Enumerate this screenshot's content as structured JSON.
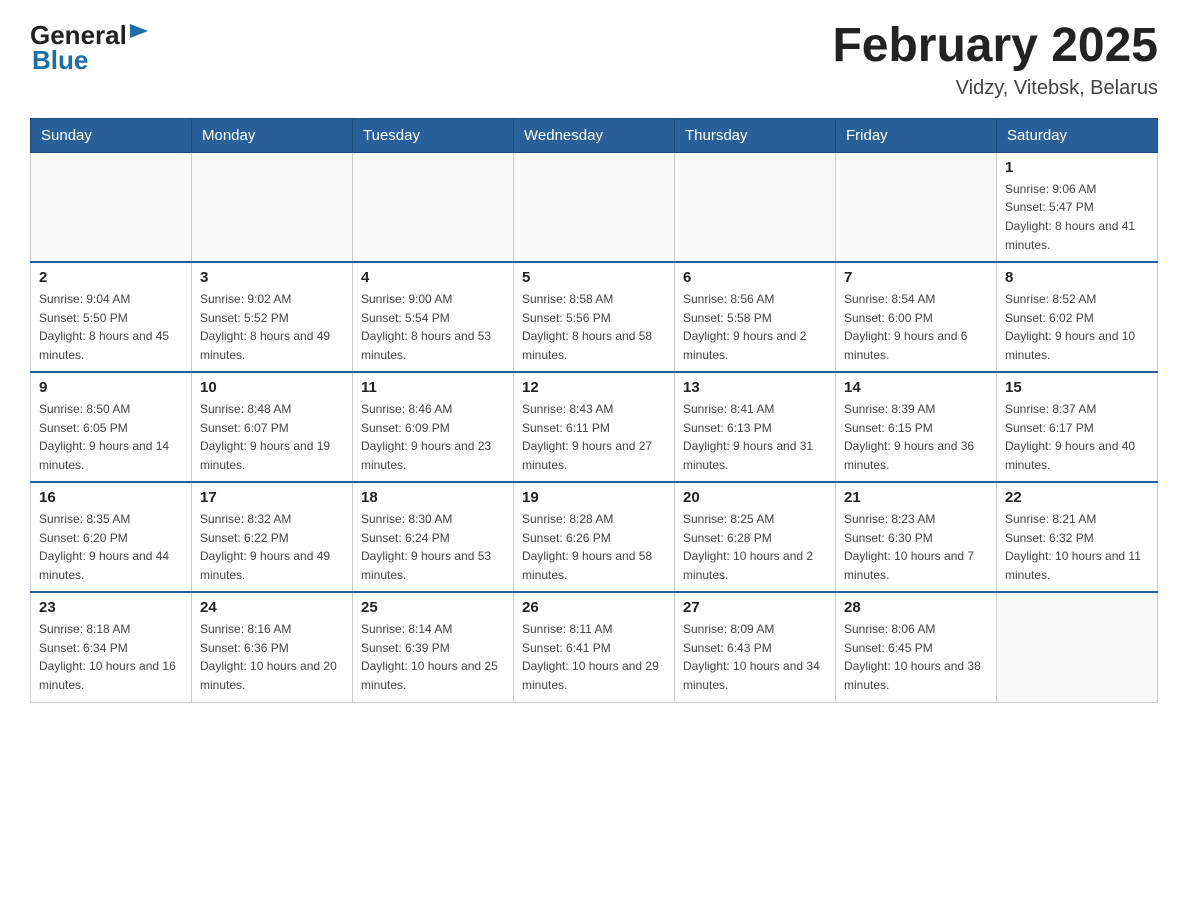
{
  "header": {
    "logo_general": "General",
    "logo_blue": "Blue",
    "month_title": "February 2025",
    "location": "Vidzy, Vitebsk, Belarus"
  },
  "days_of_week": [
    "Sunday",
    "Monday",
    "Tuesday",
    "Wednesday",
    "Thursday",
    "Friday",
    "Saturday"
  ],
  "weeks": [
    [
      {
        "day": "",
        "info": ""
      },
      {
        "day": "",
        "info": ""
      },
      {
        "day": "",
        "info": ""
      },
      {
        "day": "",
        "info": ""
      },
      {
        "day": "",
        "info": ""
      },
      {
        "day": "",
        "info": ""
      },
      {
        "day": "1",
        "info": "Sunrise: 9:06 AM\nSunset: 5:47 PM\nDaylight: 8 hours and 41 minutes."
      }
    ],
    [
      {
        "day": "2",
        "info": "Sunrise: 9:04 AM\nSunset: 5:50 PM\nDaylight: 8 hours and 45 minutes."
      },
      {
        "day": "3",
        "info": "Sunrise: 9:02 AM\nSunset: 5:52 PM\nDaylight: 8 hours and 49 minutes."
      },
      {
        "day": "4",
        "info": "Sunrise: 9:00 AM\nSunset: 5:54 PM\nDaylight: 8 hours and 53 minutes."
      },
      {
        "day": "5",
        "info": "Sunrise: 8:58 AM\nSunset: 5:56 PM\nDaylight: 8 hours and 58 minutes."
      },
      {
        "day": "6",
        "info": "Sunrise: 8:56 AM\nSunset: 5:58 PM\nDaylight: 9 hours and 2 minutes."
      },
      {
        "day": "7",
        "info": "Sunrise: 8:54 AM\nSunset: 6:00 PM\nDaylight: 9 hours and 6 minutes."
      },
      {
        "day": "8",
        "info": "Sunrise: 8:52 AM\nSunset: 6:02 PM\nDaylight: 9 hours and 10 minutes."
      }
    ],
    [
      {
        "day": "9",
        "info": "Sunrise: 8:50 AM\nSunset: 6:05 PM\nDaylight: 9 hours and 14 minutes."
      },
      {
        "day": "10",
        "info": "Sunrise: 8:48 AM\nSunset: 6:07 PM\nDaylight: 9 hours and 19 minutes."
      },
      {
        "day": "11",
        "info": "Sunrise: 8:46 AM\nSunset: 6:09 PM\nDaylight: 9 hours and 23 minutes."
      },
      {
        "day": "12",
        "info": "Sunrise: 8:43 AM\nSunset: 6:11 PM\nDaylight: 9 hours and 27 minutes."
      },
      {
        "day": "13",
        "info": "Sunrise: 8:41 AM\nSunset: 6:13 PM\nDaylight: 9 hours and 31 minutes."
      },
      {
        "day": "14",
        "info": "Sunrise: 8:39 AM\nSunset: 6:15 PM\nDaylight: 9 hours and 36 minutes."
      },
      {
        "day": "15",
        "info": "Sunrise: 8:37 AM\nSunset: 6:17 PM\nDaylight: 9 hours and 40 minutes."
      }
    ],
    [
      {
        "day": "16",
        "info": "Sunrise: 8:35 AM\nSunset: 6:20 PM\nDaylight: 9 hours and 44 minutes."
      },
      {
        "day": "17",
        "info": "Sunrise: 8:32 AM\nSunset: 6:22 PM\nDaylight: 9 hours and 49 minutes."
      },
      {
        "day": "18",
        "info": "Sunrise: 8:30 AM\nSunset: 6:24 PM\nDaylight: 9 hours and 53 minutes."
      },
      {
        "day": "19",
        "info": "Sunrise: 8:28 AM\nSunset: 6:26 PM\nDaylight: 9 hours and 58 minutes."
      },
      {
        "day": "20",
        "info": "Sunrise: 8:25 AM\nSunset: 6:28 PM\nDaylight: 10 hours and 2 minutes."
      },
      {
        "day": "21",
        "info": "Sunrise: 8:23 AM\nSunset: 6:30 PM\nDaylight: 10 hours and 7 minutes."
      },
      {
        "day": "22",
        "info": "Sunrise: 8:21 AM\nSunset: 6:32 PM\nDaylight: 10 hours and 11 minutes."
      }
    ],
    [
      {
        "day": "23",
        "info": "Sunrise: 8:18 AM\nSunset: 6:34 PM\nDaylight: 10 hours and 16 minutes."
      },
      {
        "day": "24",
        "info": "Sunrise: 8:16 AM\nSunset: 6:36 PM\nDaylight: 10 hours and 20 minutes."
      },
      {
        "day": "25",
        "info": "Sunrise: 8:14 AM\nSunset: 6:39 PM\nDaylight: 10 hours and 25 minutes."
      },
      {
        "day": "26",
        "info": "Sunrise: 8:11 AM\nSunset: 6:41 PM\nDaylight: 10 hours and 29 minutes."
      },
      {
        "day": "27",
        "info": "Sunrise: 8:09 AM\nSunset: 6:43 PM\nDaylight: 10 hours and 34 minutes."
      },
      {
        "day": "28",
        "info": "Sunrise: 8:06 AM\nSunset: 6:45 PM\nDaylight: 10 hours and 38 minutes."
      },
      {
        "day": "",
        "info": ""
      }
    ]
  ]
}
